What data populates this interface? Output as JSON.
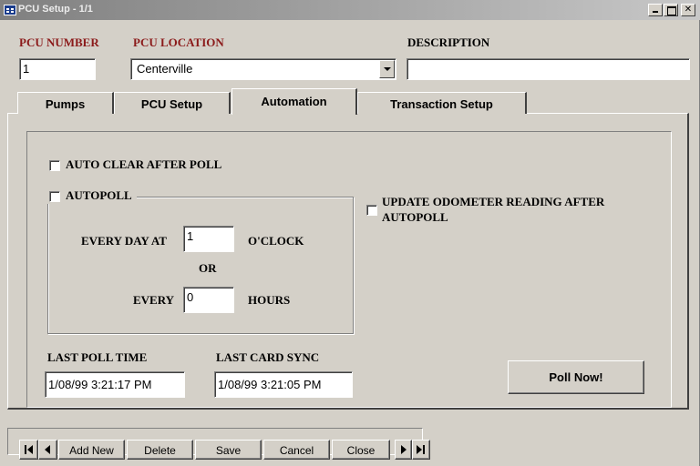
{
  "window": {
    "title": "PCU Setup - 1/1",
    "controls": [
      "minimize",
      "maximize",
      "close"
    ],
    "close_glyph": "✕"
  },
  "header": {
    "pcu_number_label": "PCU NUMBER",
    "pcu_number_value": "1",
    "pcu_location_label": "PCU LOCATION",
    "pcu_location_value": "Centerville",
    "description_label": "DESCRIPTION",
    "description_value": ""
  },
  "tabs": [
    {
      "label": "Pumps",
      "active": false
    },
    {
      "label": "PCU Setup",
      "active": false
    },
    {
      "label": "Automation",
      "active": true
    },
    {
      "label": "Transaction Setup",
      "active": false
    }
  ],
  "automation": {
    "auto_clear_label": "AUTO CLEAR AFTER POLL",
    "auto_clear_checked": false,
    "autopoll_label": "AUTOPOLL",
    "autopoll_checked": false,
    "every_day_at_label": "EVERY DAY AT",
    "every_day_at_value": "1",
    "oclock_label": "O'CLOCK",
    "or_label": "OR",
    "every_label": "EVERY",
    "every_value": "0",
    "hours_label": "HOURS",
    "update_odometer_label_line1": "UPDATE ODOMETER READING AFTER",
    "update_odometer_label_line2": "AUTOPOLL",
    "update_odometer_checked": false,
    "last_poll_time_label": "LAST POLL TIME",
    "last_poll_time_value": "1/08/99 3:21:17 PM",
    "last_card_sync_label": "LAST CARD SYNC",
    "last_card_sync_value": "1/08/99 3:21:05 PM",
    "poll_now_label": "Poll Now!"
  },
  "nav": {
    "add_new": "Add New",
    "delete": "Delete",
    "save": "Save",
    "cancel": "Cancel",
    "close": "Close",
    "icons": [
      "first-record-icon",
      "previous-record-icon",
      "next-record-icon",
      "last-record-icon"
    ]
  },
  "colors": {
    "label_red": "#8b1a1a",
    "face": "#d4d0c8"
  }
}
